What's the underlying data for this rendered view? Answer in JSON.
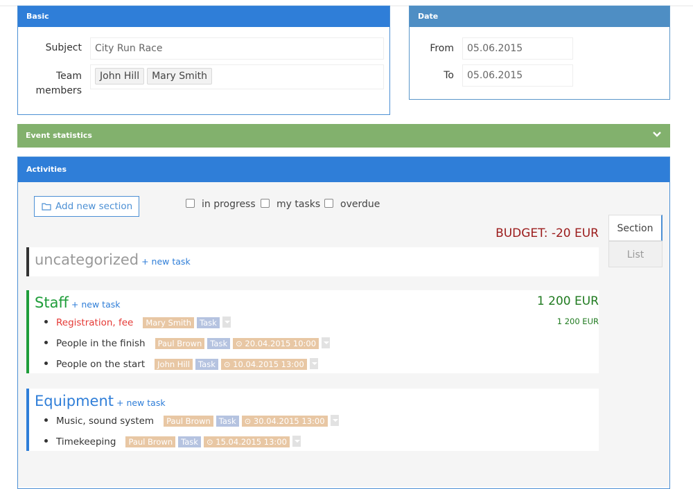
{
  "basic": {
    "title": "Basic",
    "subject_label": "Subject",
    "subject_value": "City Run Race",
    "team_label_1": "Team",
    "team_label_2": "members",
    "team_members": [
      "John Hill",
      "Mary Smith"
    ]
  },
  "date": {
    "title": "Date",
    "from_label": "From",
    "from_value": "05.06.2015",
    "to_label": "To",
    "to_value": "05.06.2015"
  },
  "stats": {
    "title": "Event statistics",
    "icon": "chevron-down-icon"
  },
  "activities": {
    "title": "Activities",
    "add_section_label": "Add new section",
    "filters": [
      "in progress",
      "my tasks",
      "overdue"
    ],
    "budget": "BUDGET: -20 EUR",
    "tabs": [
      "Section",
      "List"
    ],
    "new_task_label": "+ new task",
    "sections": [
      {
        "name": "uncategorized",
        "color": "#999999",
        "border": "#333333",
        "total": "",
        "tasks": []
      },
      {
        "name": "Staff",
        "color": "#1f9d3a",
        "border": "#1f9d3a",
        "total": "1 200 EUR",
        "tasks": [
          {
            "name": "Registration, fee",
            "person": "Mary Smith",
            "type": "Task",
            "due": "",
            "amount": "1 200 EUR",
            "overdue": true
          },
          {
            "name": "People in the finish",
            "person": "Paul Brown",
            "type": "Task",
            "due": "20.04.2015 10:00",
            "amount": "",
            "overdue": false
          },
          {
            "name": "People on the start",
            "person": "John Hill",
            "type": "Task",
            "due": "10.04.2015 13:00",
            "amount": "",
            "overdue": false
          }
        ]
      },
      {
        "name": "Equipment",
        "color": "#2f7ed8",
        "border": "#2f7ed8",
        "total": "",
        "tasks": [
          {
            "name": "Music, sound system",
            "person": "Paul Brown",
            "type": "Task",
            "due": "30.04.2015 13:00",
            "amount": "",
            "overdue": false
          },
          {
            "name": "Timekeeping",
            "person": "Paul Brown",
            "type": "Task",
            "due": "15.04.2015 13:00",
            "amount": "",
            "overdue": false
          }
        ]
      }
    ]
  },
  "colors": {
    "primary": "#2f7ed8",
    "success": "#82b16d",
    "budget": "#9b1b1b",
    "overdue": "#e53935"
  }
}
